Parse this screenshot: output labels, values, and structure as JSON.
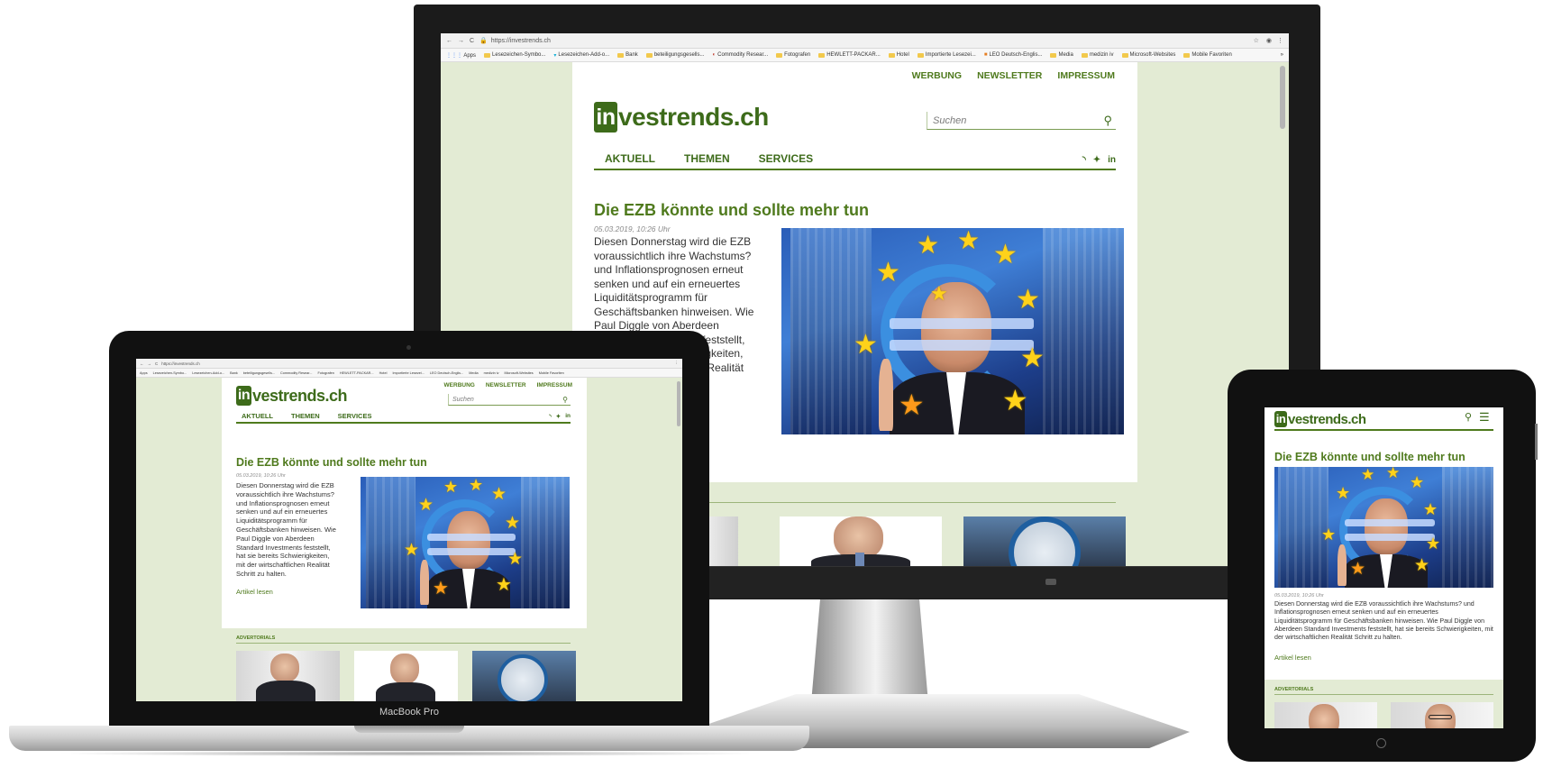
{
  "browser": {
    "url": "https://investrends.ch",
    "apps_label": "Apps",
    "bookmarks": [
      "Lesezeichen-Symbo...",
      "Lesezeichen-Add-o...",
      "Bank",
      "beteiligungsgesells...",
      "Commodity Resear...",
      "Fotografen",
      "HEWLETT-PACKAR...",
      "Hotel",
      "Importierte Lesezei...",
      "LEO Deutsch-Englis...",
      "Media",
      "medizin iv",
      "Microsoft-Websites",
      "Mobile Favoriten"
    ],
    "more": "»"
  },
  "site": {
    "logo_in": "in",
    "logo_rest": "vestrends.ch",
    "top_links": [
      "WERBUNG",
      "NEWSLETTER",
      "IMPRESSUM"
    ],
    "search_placeholder": "Suchen",
    "nav": [
      "AKTUELL",
      "THEMEN",
      "SERVICES"
    ],
    "social": [
      "rss",
      "twitter",
      "in"
    ],
    "article": {
      "title": "Die EZB könnte und sollte mehr tun",
      "date": "05.03.2019, 10:26 Uhr",
      "teaser": "Diesen Donnerstag wird die EZB voraussichtlich ihre Wachstums? und Inflationsprognosen erneut senken und auf ein erneuertes Liquiditätsprogramm für Geschäftsbanken hinweisen. Wie Paul Diggle von Aberdeen Standard Investments feststellt, hat sie bereits Schwierigkeiten, mit der wirtschaftlichen Realität Schritt zu halten.",
      "teaser_tablet": "Diesen Donnerstag wird die EZB voraussichtlich ihre Wachstums? und Inflationsprognosen erneut senken und auf ein erneuertes Liquiditätsprogramm für Geschäftsbanken hinweisen. Wie Paul Diggle von Aberdeen Standard Investments feststellt, hat sie bereits Schwierigkeiten, mit der wirtschaftlichen Realität Schritt zu halten.",
      "read_more": "Artikel lesen"
    },
    "advertorials_label": "ADVERTORIALS"
  },
  "devices": {
    "laptop_brand": "MacBook Pro"
  },
  "monitor_teaser_lines": [
    "Diesen Donnerstag wird die EZB",
    "voraussichtlich ihre Wachstums?",
    "und Inflationsprognosen erneut",
    "senken und auf ein erneuertes",
    "Liquiditätsprogramm für",
    "Geschäftsbanken hinweisen. Wie",
    "Paul Diggle von Aberdeen",
    "Standard Investments feststellt,",
    "hat sie bereits Schwierigkeiten,",
    "mit der wirtschaftlichen Realität"
  ],
  "laptop_teaser_lines": [
    "Diesen Donnerstag wird die EZB",
    "voraussichtlich ihre Wachstums?",
    "und Inflationsprognosen erneut",
    "senken und auf ein erneuertes",
    "Liquiditätsprogramm für",
    "Geschäftsbanken hinweisen. Wie",
    "Paul Diggle von Aberdeen",
    "Standard Investments feststellt,",
    "hat sie bereits Schwierigkeiten,",
    "mit der wirtschaftlichen Realität",
    "Schritt zu halten."
  ],
  "colors": {
    "brand_green": "#3d6b1a",
    "link_green": "#4f7a1d",
    "site_background": "#e3ebd4"
  }
}
